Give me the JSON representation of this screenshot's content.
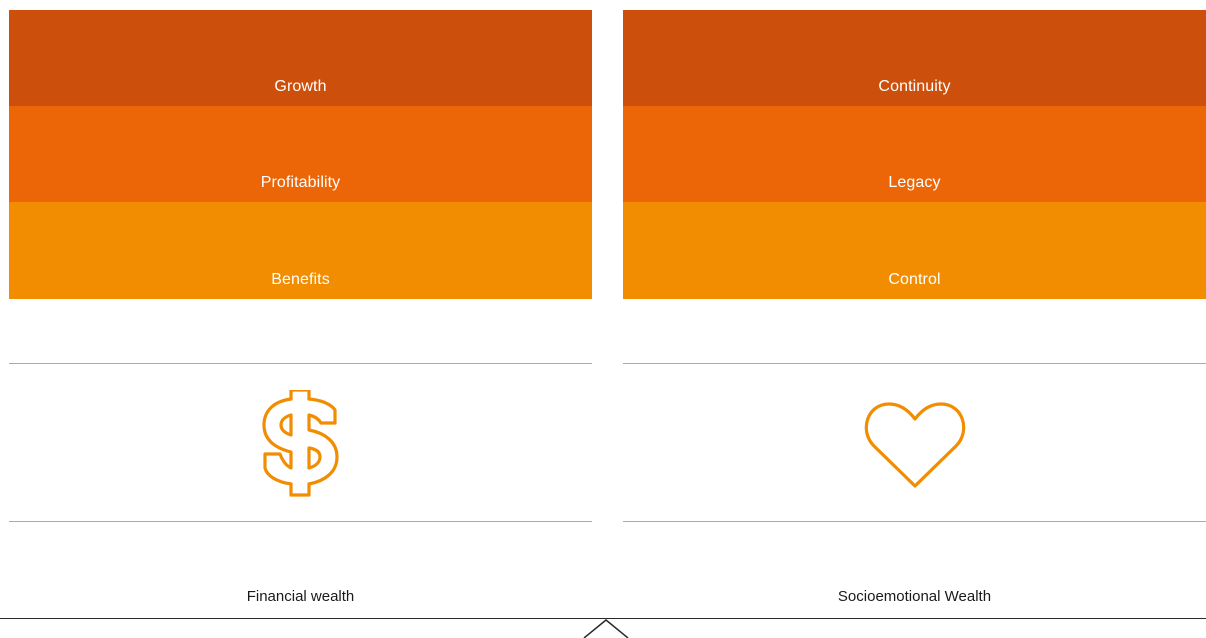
{
  "colors": {
    "band_dark": "#cc4f0c",
    "band_mid": "#ec6608",
    "band_light": "#f28c00",
    "rule": "#f0a033",
    "icon": "#f28c00",
    "baseline": "#2a2a2a"
  },
  "left": {
    "bands": [
      {
        "label": "Growth"
      },
      {
        "label": "Profitability"
      },
      {
        "label": "Benefits"
      }
    ],
    "icon": "dollar-sign-icon",
    "caption": "Financial wealth"
  },
  "right": {
    "bands": [
      {
        "label": "Continuity"
      },
      {
        "label": "Legacy"
      },
      {
        "label": "Control"
      }
    ],
    "icon": "heart-icon",
    "caption": "Socioemotional Wealth"
  }
}
